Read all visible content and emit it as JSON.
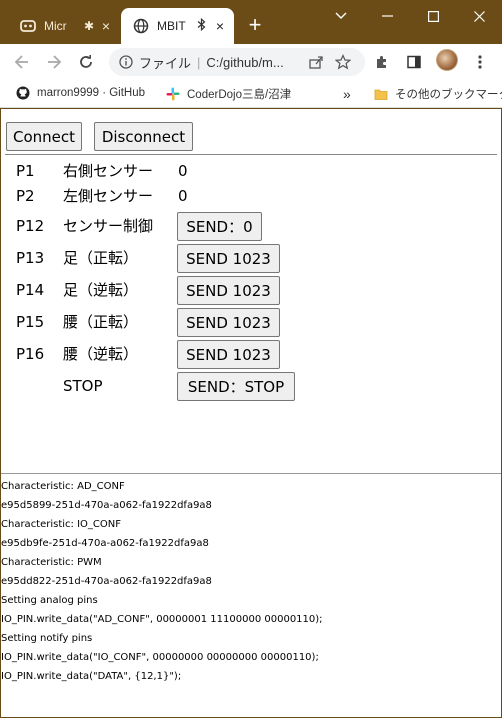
{
  "browser": {
    "tabs": [
      {
        "label": "Micr",
        "icon": "gamepad-icon",
        "close": "×"
      },
      {
        "label": "MBIT",
        "icon": "globe-icon",
        "badge": "✱",
        "close": "×"
      }
    ],
    "new_tab": "+",
    "window_controls": {
      "minimize": "—",
      "maximize": "☐",
      "close": "✕"
    },
    "address": {
      "info_label": "ファイル",
      "url": "C:/github/m..."
    },
    "bookmarks": [
      {
        "label": "marron9999 · GitHub",
        "icon": "github-icon"
      },
      {
        "label": "CoderDojo三島/沼津",
        "icon": "slack-icon"
      }
    ],
    "bookmarks_more": "»",
    "other_bookmarks": "その他のブックマーク"
  },
  "page": {
    "connect_label": "Connect",
    "disconnect_label": "Disconnect",
    "rows": [
      {
        "pin": "P1",
        "name": "右側センサー",
        "value": "0"
      },
      {
        "pin": "P2",
        "name": "左側センサー",
        "value": "0"
      },
      {
        "pin": "P12",
        "name": "センサー制御",
        "button": "SEND：0"
      },
      {
        "pin": "P13",
        "name": "足（正転）",
        "button": "SEND 1023"
      },
      {
        "pin": "P14",
        "name": "足（逆転）",
        "button": "SEND 1023"
      },
      {
        "pin": "P15",
        "name": "腰（正転）",
        "button": "SEND 1023"
      },
      {
        "pin": "P16",
        "name": "腰（逆転）",
        "button": "SEND 1023"
      },
      {
        "pin": "",
        "name": "STOP",
        "button": "SEND：STOP"
      }
    ],
    "log": [
      "Characteristic: AD_CONF",
      "e95d5899-251d-470a-a062-fa1922dfa9a8",
      "Characteristic: IO_CONF",
      "e95db9fe-251d-470a-a062-fa1922dfa9a8",
      "Characteristic: PWM",
      "e95dd822-251d-470a-a062-fa1922dfa9a8",
      "Setting analog pins",
      "IO_PIN.write_data(\"AD_CONF\", 00000001 11100000 00000110);",
      "Setting notify pins",
      "IO_PIN.write_data(\"IO_CONF\", 00000000 00000000 00000110);",
      "IO_PIN.write_data(\"DATA\", {12,1}\");"
    ]
  }
}
